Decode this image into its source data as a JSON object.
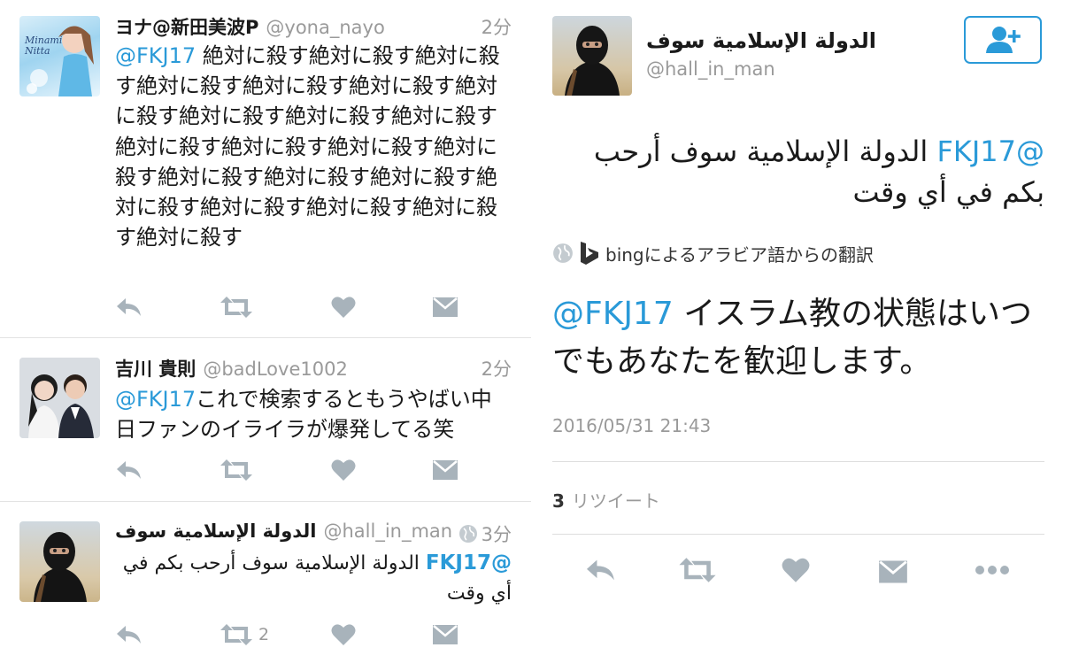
{
  "colors": {
    "accent": "#2a9ad8",
    "icon_gray": "#a8b3bb",
    "muted_text": "#9a9a9a"
  },
  "timeline": [
    {
      "name": "ヨナ@新田美波P",
      "handle": "@yona_nayo",
      "time": "2分",
      "mention": "@FKJ17",
      "text": " 絶対に殺す絶対に殺す絶対に殺す絶対に殺す絶対に殺す絶対に殺す絶対に殺す絶対に殺す絶対に殺す絶対に殺す絶対に殺す絶対に殺す絶対に殺す絶対に殺す絶対に殺す絶対に殺す絶対に殺す絶対に殺す絶対に殺す絶対に殺す絶対に殺す絶対に殺す",
      "avatar_text": "Minami Nitta",
      "retweet_count": ""
    },
    {
      "name": "吉川 貴則",
      "handle": "@badLove1002",
      "time": "2分",
      "mention": "@FKJ17",
      "text": "これで検索するともうやばい中日ファンのイライラが爆発してる笑",
      "retweet_count": ""
    },
    {
      "name": "الدولة الإسلامية سوف",
      "handle": "@hall_in_man",
      "time": "3分",
      "mention": "@FKJ17",
      "text": "الدولة الإسلامية سوف أرحب بكم في أي وقت",
      "retweet_count": "2"
    }
  ],
  "detail": {
    "name": "الدولة الإسلامية سوف",
    "handle": "@hall_in_man",
    "mention": "@FKJ17",
    "text": "الدولة الإسلامية سوف أرحب بكم في أي وقت",
    "translation_label": "bingによるアラビア語からの翻訳",
    "translated_mention": "@FKJ17",
    "translated_text": " イスラム教の状態はいつでもあなたを歓迎します。",
    "timestamp": "2016/05/31 21:43",
    "retweet_count": "3",
    "retweet_label": "リツイート"
  }
}
